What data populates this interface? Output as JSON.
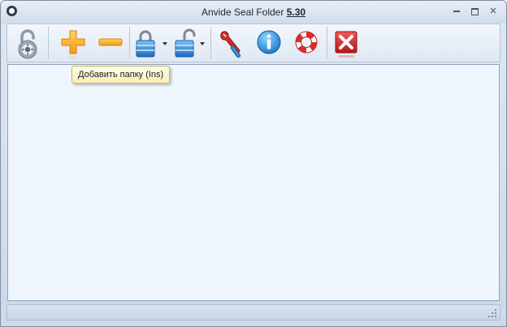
{
  "window": {
    "title": "Anvide Seal Folder",
    "version": "5.30"
  },
  "toolbar": {
    "buttons": [
      {
        "name": "lock-program-icon"
      },
      {
        "name": "add-folder-icon"
      },
      {
        "name": "remove-folder-icon"
      },
      {
        "name": "lock-folder-icon",
        "has_dropdown": true
      },
      {
        "name": "unlock-folder-icon",
        "has_dropdown": true
      },
      {
        "name": "settings-wrench-icon"
      },
      {
        "name": "info-icon"
      },
      {
        "name": "help-lifebuoy-icon"
      },
      {
        "name": "exit-icon"
      }
    ]
  },
  "tooltip": {
    "text": "Добавить папку (Ins)"
  },
  "colors": {
    "window_bg": "#cdd9e8",
    "content_bg": "#f0f6fe",
    "tooltip_bg": "#f6efb8",
    "exit_red": "#d4272a",
    "accent_orange": "#f5a623",
    "info_blue": "#1e8fe0"
  }
}
